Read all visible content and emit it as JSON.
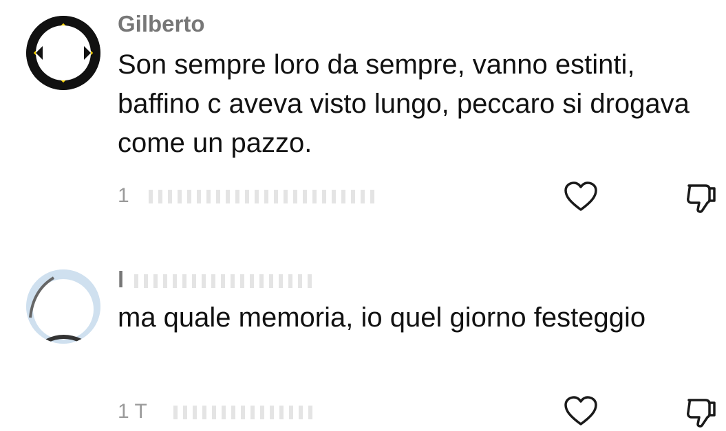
{
  "comments": [
    {
      "author": "Gilberto",
      "text": "Son sempre loro da sempre, vanno estinti, baffino c aveva visto lungo, peccaro si drogava come un pazzo.",
      "meta": "1",
      "avatar_icon": "avatar-image",
      "like_icon": "heart-icon",
      "dislike_icon": "thumbs-down-icon"
    },
    {
      "author": "l",
      "text": "ma quale memoria, io quel giorno festeggio",
      "meta": "1 T",
      "avatar_icon": "avatar-image",
      "like_icon": "heart-icon",
      "dislike_icon": "thumbs-down-icon"
    }
  ],
  "colors": {
    "author": "#777777",
    "text": "#111111",
    "meta": "#9a9a9a",
    "icon": "#1a1a1a",
    "avatar1_ring": "#111111",
    "avatar1_accent": "#f4d000",
    "avatar2_bg": "#cfe0ef"
  }
}
